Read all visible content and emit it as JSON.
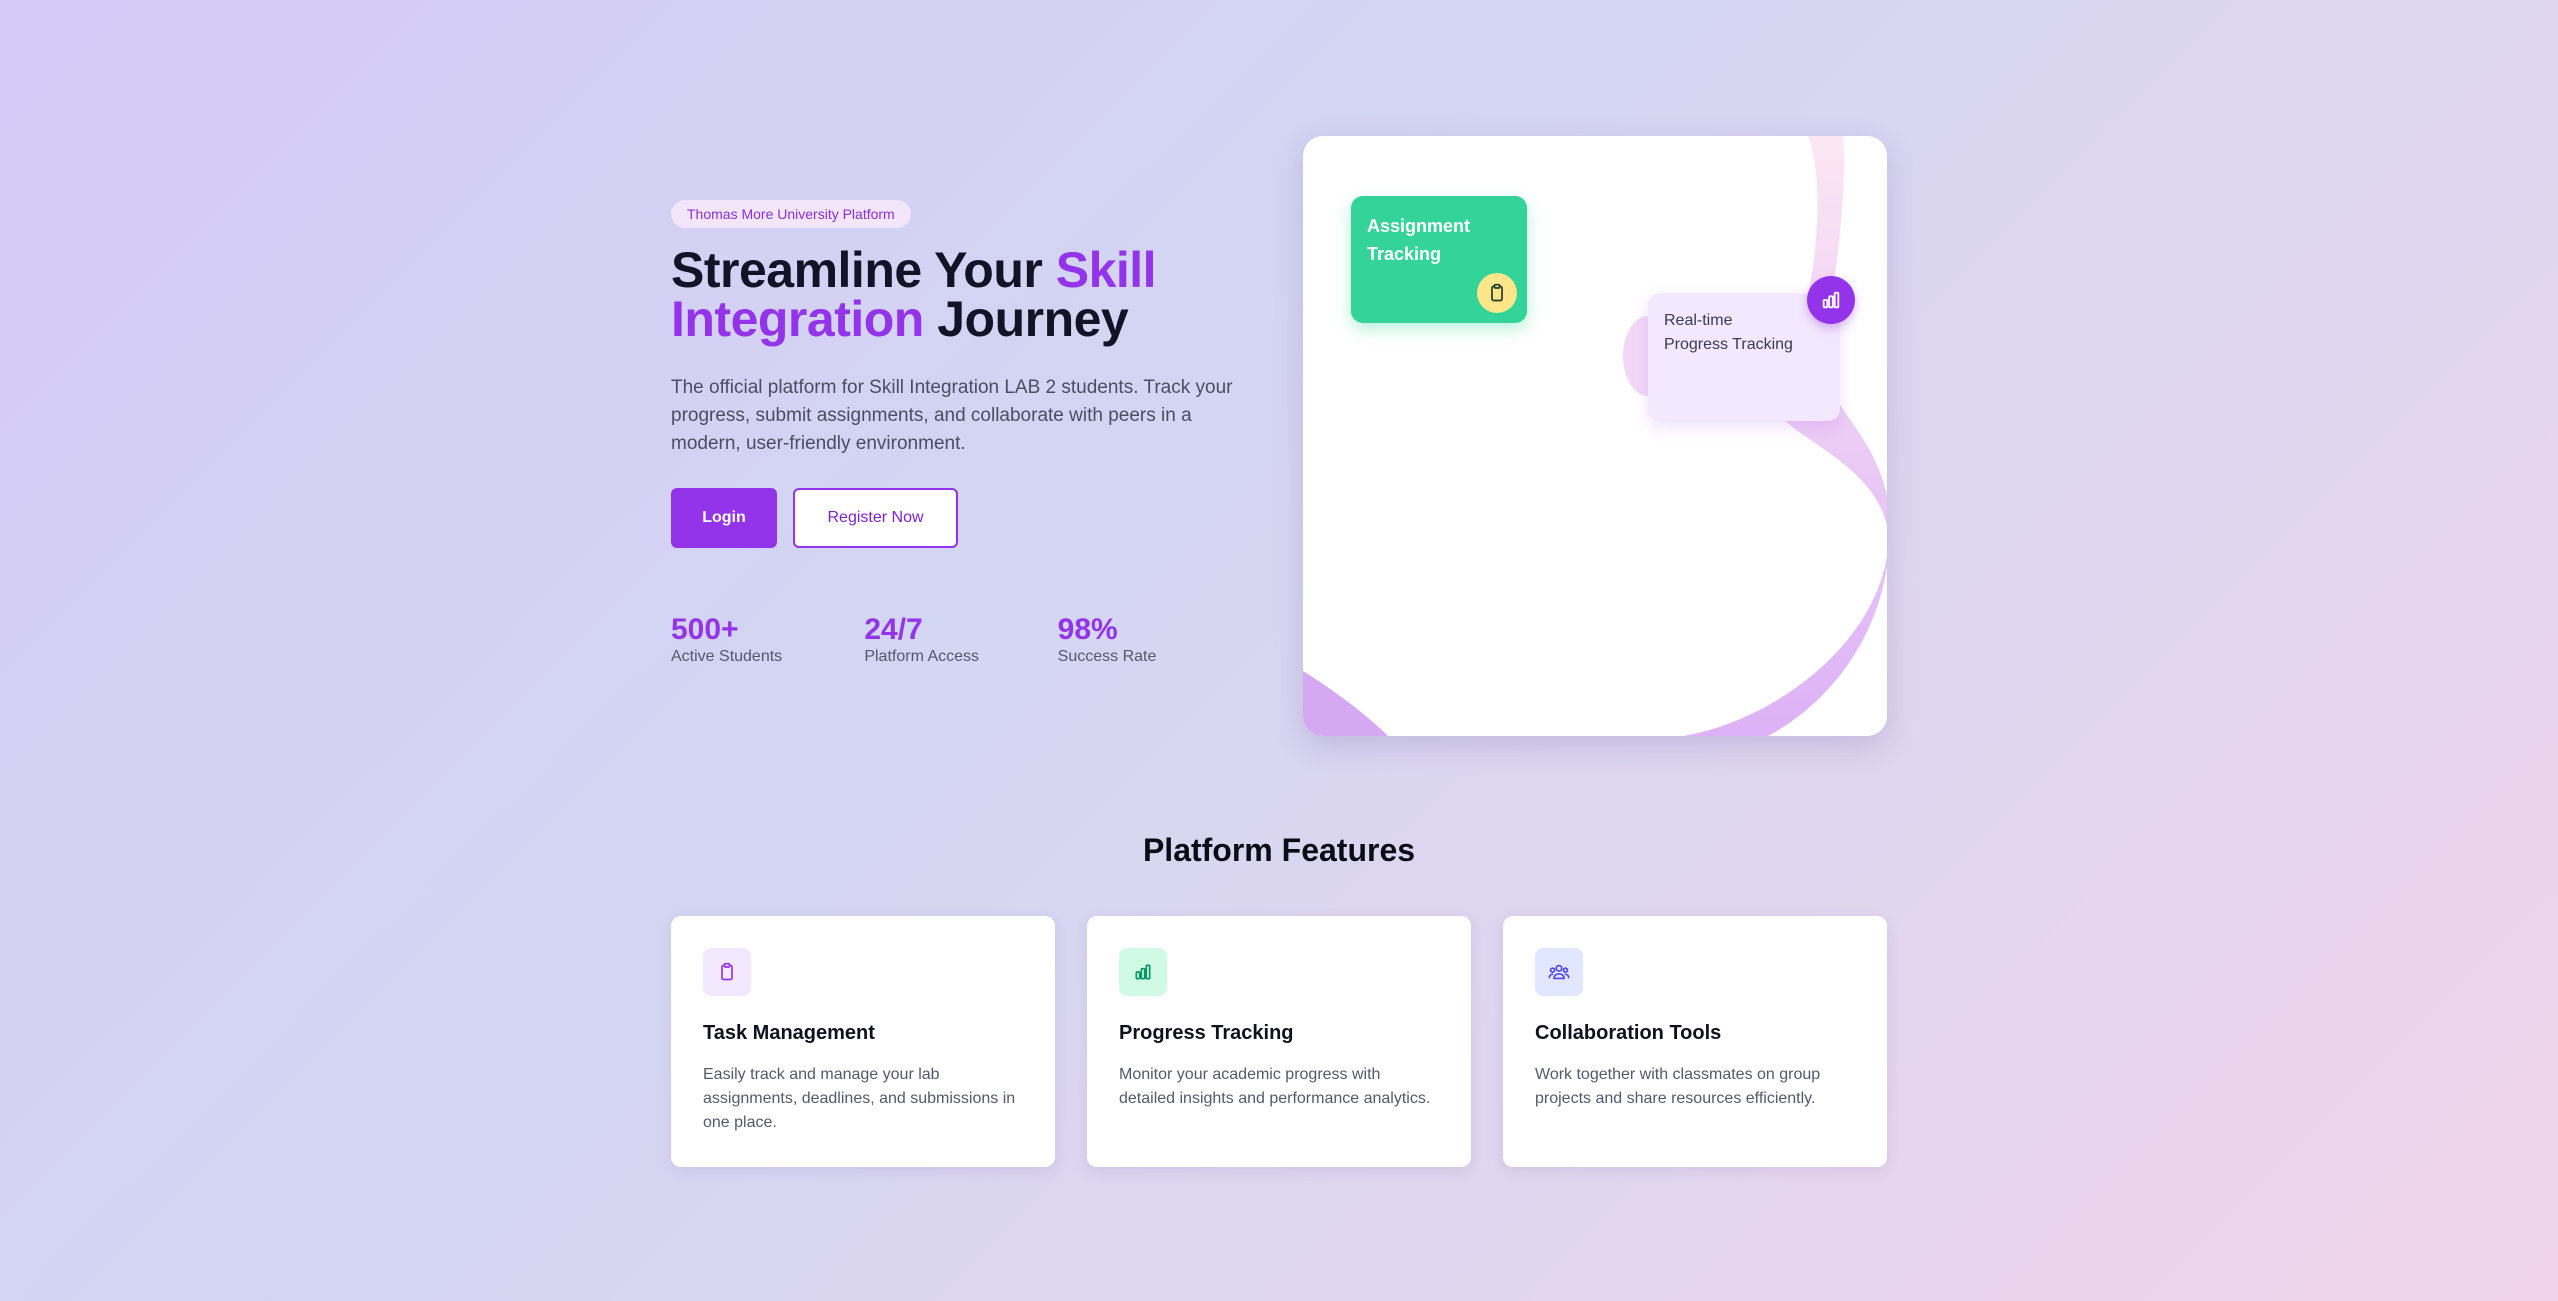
{
  "hero": {
    "badge": "Thomas More University Platform",
    "headline": {
      "part1": "Streamline Your ",
      "accent1": "Skill",
      "accent2": "Integration",
      "part2": " Journey"
    },
    "description": "The official platform for Skill Integration LAB 2 students. Track your progress, submit assignments, and collaborate with peers in a modern, user-friendly environment.",
    "login_label": "Login",
    "register_label": "Register Now",
    "stats": [
      {
        "value": "500+",
        "label": "Active Students"
      },
      {
        "value": "24/7",
        "label": "Platform Access"
      },
      {
        "value": "98%",
        "label": "Success Rate"
      }
    ]
  },
  "illustration": {
    "assignment_card": "Assignment Tracking",
    "assignment_icon": "clipboard-icon",
    "progress_card_line1": "Real-time",
    "progress_card_line2": "Progress Tracking",
    "progress_icon": "bar-chart-icon"
  },
  "features": {
    "title": "Platform Features",
    "items": [
      {
        "icon": "clipboard-icon",
        "title": "Task Management",
        "description": "Easily track and manage your lab assignments, deadlines, and submissions in one place."
      },
      {
        "icon": "bar-chart-icon",
        "title": "Progress Tracking",
        "description": "Monitor your academic progress with detailed insights and performance analytics."
      },
      {
        "icon": "users-icon",
        "title": "Collaboration Tools",
        "description": "Work together with classmates on group projects and share resources efficiently."
      }
    ]
  },
  "colors": {
    "primary": "#9333ea",
    "green": "#34d399",
    "yellow": "#fde68a",
    "lavender": "#f3e8fd"
  }
}
